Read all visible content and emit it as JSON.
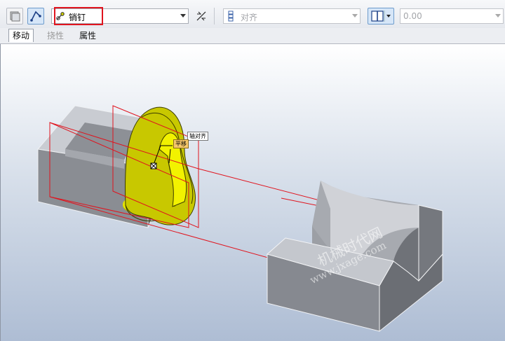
{
  "toolbar": {
    "constraint_type": "销钉",
    "align_placeholder": "对齐",
    "offset_value": "0.00"
  },
  "tabs": [
    {
      "label": "移动",
      "state": "selected"
    },
    {
      "label": "挠性",
      "state": "disabled"
    },
    {
      "label": "属性",
      "state": "normal"
    }
  ],
  "viewport": {
    "callouts": {
      "pin_axis": "轴对齐",
      "translation": "平移"
    },
    "watermark": {
      "line1": "机械时代网",
      "line2": "www.jxage.com"
    }
  },
  "colors": {
    "highlight_box": "#e0141e",
    "datum_plane": "#e0141e",
    "part_yellow": "#d8d800",
    "part_gray": "#8f9298"
  }
}
